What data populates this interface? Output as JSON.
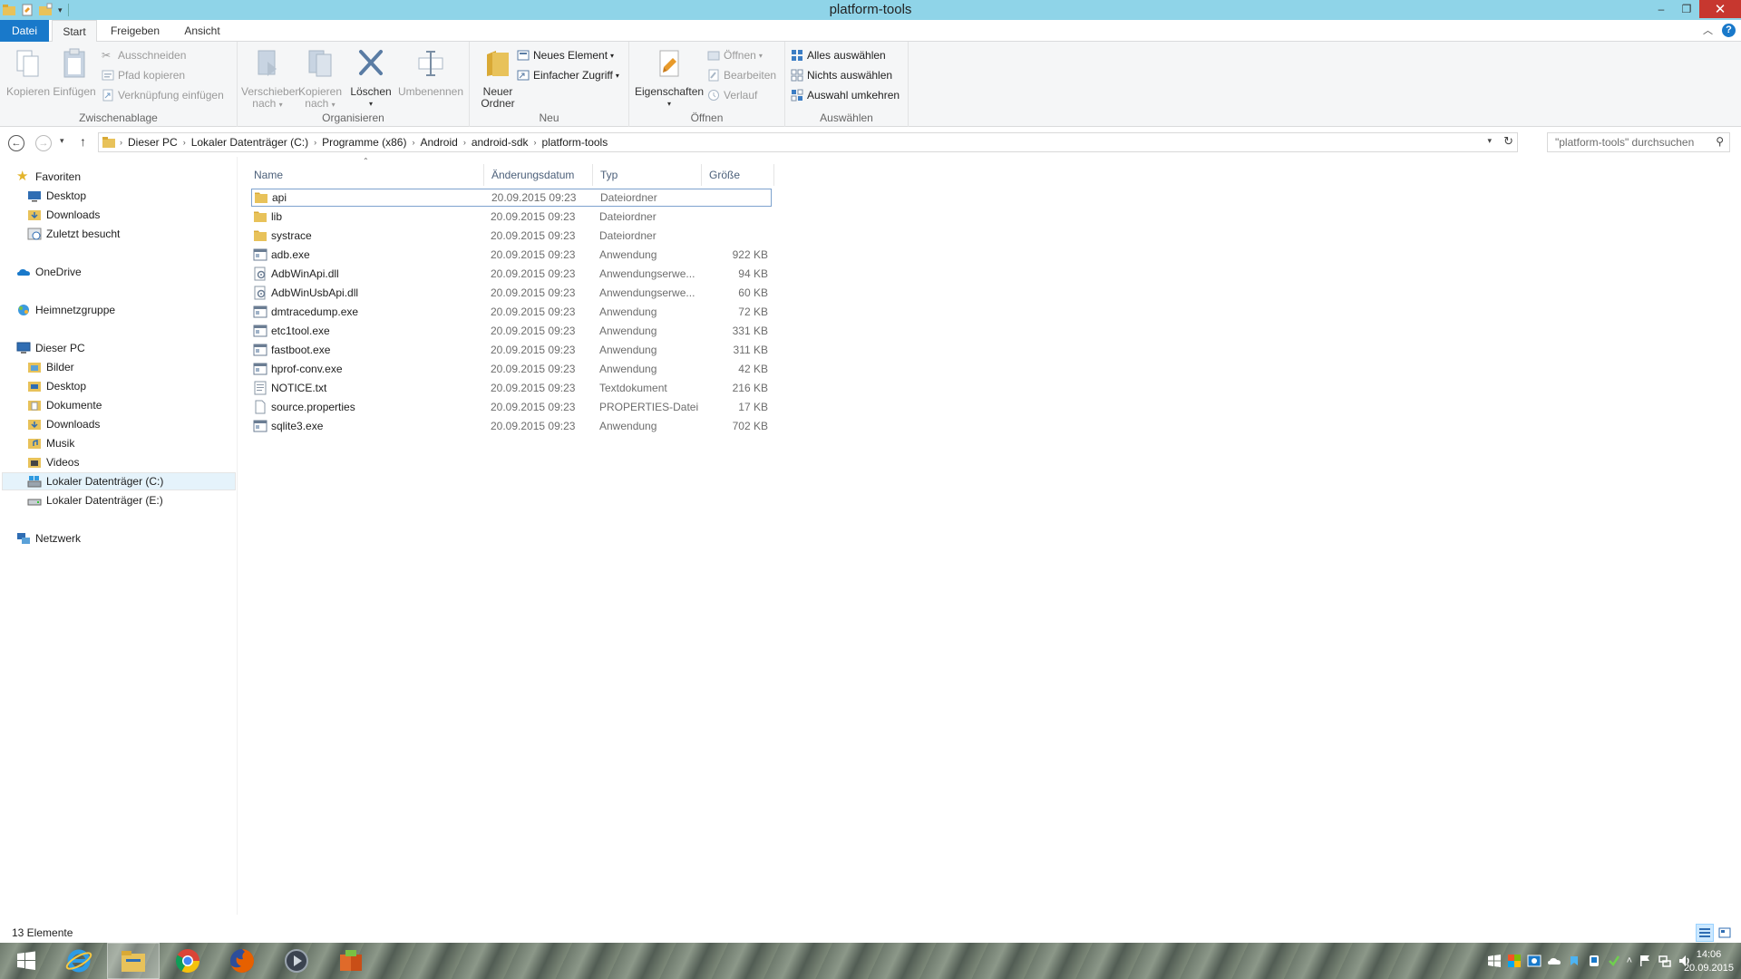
{
  "window": {
    "title": "platform-tools",
    "controls": {
      "minimize": "–",
      "restore": "❐",
      "close": "✕"
    }
  },
  "ribbon_tabs": {
    "file": "Datei",
    "start": "Start",
    "share": "Freigeben",
    "view": "Ansicht"
  },
  "ribbon": {
    "clipboard": {
      "label": "Zwischenablage",
      "copy": "Kopieren",
      "paste": "Einfügen",
      "cut": "Ausschneiden",
      "copy_path": "Pfad kopieren",
      "paste_shortcut": "Verknüpfung einfügen"
    },
    "organize": {
      "label": "Organisieren",
      "move_to_1": "Verschieben",
      "move_to_2": "nach",
      "copy_to_1": "Kopieren",
      "copy_to_2": "nach",
      "delete": "Löschen",
      "rename": "Umbenennen"
    },
    "new": {
      "label": "Neu",
      "new_folder_1": "Neuer",
      "new_folder_2": "Ordner",
      "new_item": "Neues Element",
      "easy_access": "Einfacher Zugriff"
    },
    "open": {
      "label": "Öffnen",
      "properties": "Eigenschaften",
      "open": "Öffnen",
      "edit": "Bearbeiten",
      "history": "Verlauf"
    },
    "select": {
      "label": "Auswählen",
      "select_all": "Alles auswählen",
      "select_none": "Nichts auswählen",
      "invert": "Auswahl umkehren"
    }
  },
  "address": {
    "crumbs": [
      "Dieser PC",
      "Lokaler Datenträger (C:)",
      "Programme (x86)",
      "Android",
      "android-sdk",
      "platform-tools"
    ],
    "search_placeholder": "\"platform-tools\" durchsuchen"
  },
  "nav": {
    "favorites": "Favoriten",
    "fav_items": [
      "Desktop",
      "Downloads",
      "Zuletzt besucht"
    ],
    "onedrive": "OneDrive",
    "homegroup": "Heimnetzgruppe",
    "this_pc": "Dieser PC",
    "pc_items": [
      "Bilder",
      "Desktop",
      "Dokumente",
      "Downloads",
      "Musik",
      "Videos",
      "Lokaler Datenträger (C:)",
      "Lokaler Datenträger (E:)"
    ],
    "network": "Netzwerk"
  },
  "columns": {
    "name": "Name",
    "date": "Änderungsdatum",
    "type": "Typ",
    "size": "Größe"
  },
  "files": [
    {
      "name": "api",
      "date": "20.09.2015 09:23",
      "type": "Dateiordner",
      "size": "",
      "icon": "folder-icon"
    },
    {
      "name": "lib",
      "date": "20.09.2015 09:23",
      "type": "Dateiordner",
      "size": "",
      "icon": "folder-icon"
    },
    {
      "name": "systrace",
      "date": "20.09.2015 09:23",
      "type": "Dateiordner",
      "size": "",
      "icon": "folder-icon"
    },
    {
      "name": "adb.exe",
      "date": "20.09.2015 09:23",
      "type": "Anwendung",
      "size": "922 KB",
      "icon": "exe-icon"
    },
    {
      "name": "AdbWinApi.dll",
      "date": "20.09.2015 09:23",
      "type": "Anwendungserwe...",
      "size": "94 KB",
      "icon": "dll-icon"
    },
    {
      "name": "AdbWinUsbApi.dll",
      "date": "20.09.2015 09:23",
      "type": "Anwendungserwe...",
      "size": "60 KB",
      "icon": "dll-icon"
    },
    {
      "name": "dmtracedump.exe",
      "date": "20.09.2015 09:23",
      "type": "Anwendung",
      "size": "72 KB",
      "icon": "exe-icon"
    },
    {
      "name": "etc1tool.exe",
      "date": "20.09.2015 09:23",
      "type": "Anwendung",
      "size": "331 KB",
      "icon": "exe-icon"
    },
    {
      "name": "fastboot.exe",
      "date": "20.09.2015 09:23",
      "type": "Anwendung",
      "size": "311 KB",
      "icon": "exe-icon"
    },
    {
      "name": "hprof-conv.exe",
      "date": "20.09.2015 09:23",
      "type": "Anwendung",
      "size": "42 KB",
      "icon": "exe-icon"
    },
    {
      "name": "NOTICE.txt",
      "date": "20.09.2015 09:23",
      "type": "Textdokument",
      "size": "216 KB",
      "icon": "text-file-icon"
    },
    {
      "name": "source.properties",
      "date": "20.09.2015 09:23",
      "type": "PROPERTIES-Datei",
      "size": "17 KB",
      "icon": "file-icon"
    },
    {
      "name": "sqlite3.exe",
      "date": "20.09.2015 09:23",
      "type": "Anwendung",
      "size": "702 KB",
      "icon": "exe-icon"
    }
  ],
  "status": {
    "count": "13 Elemente"
  },
  "taskbar": {
    "time": "14:06",
    "date": "20.09.2015"
  },
  "colors": {
    "accent": "#1979ca",
    "titlebar": "#8fd4e8",
    "folder": "#e8c25a",
    "selection_border": "#7da2ce"
  }
}
